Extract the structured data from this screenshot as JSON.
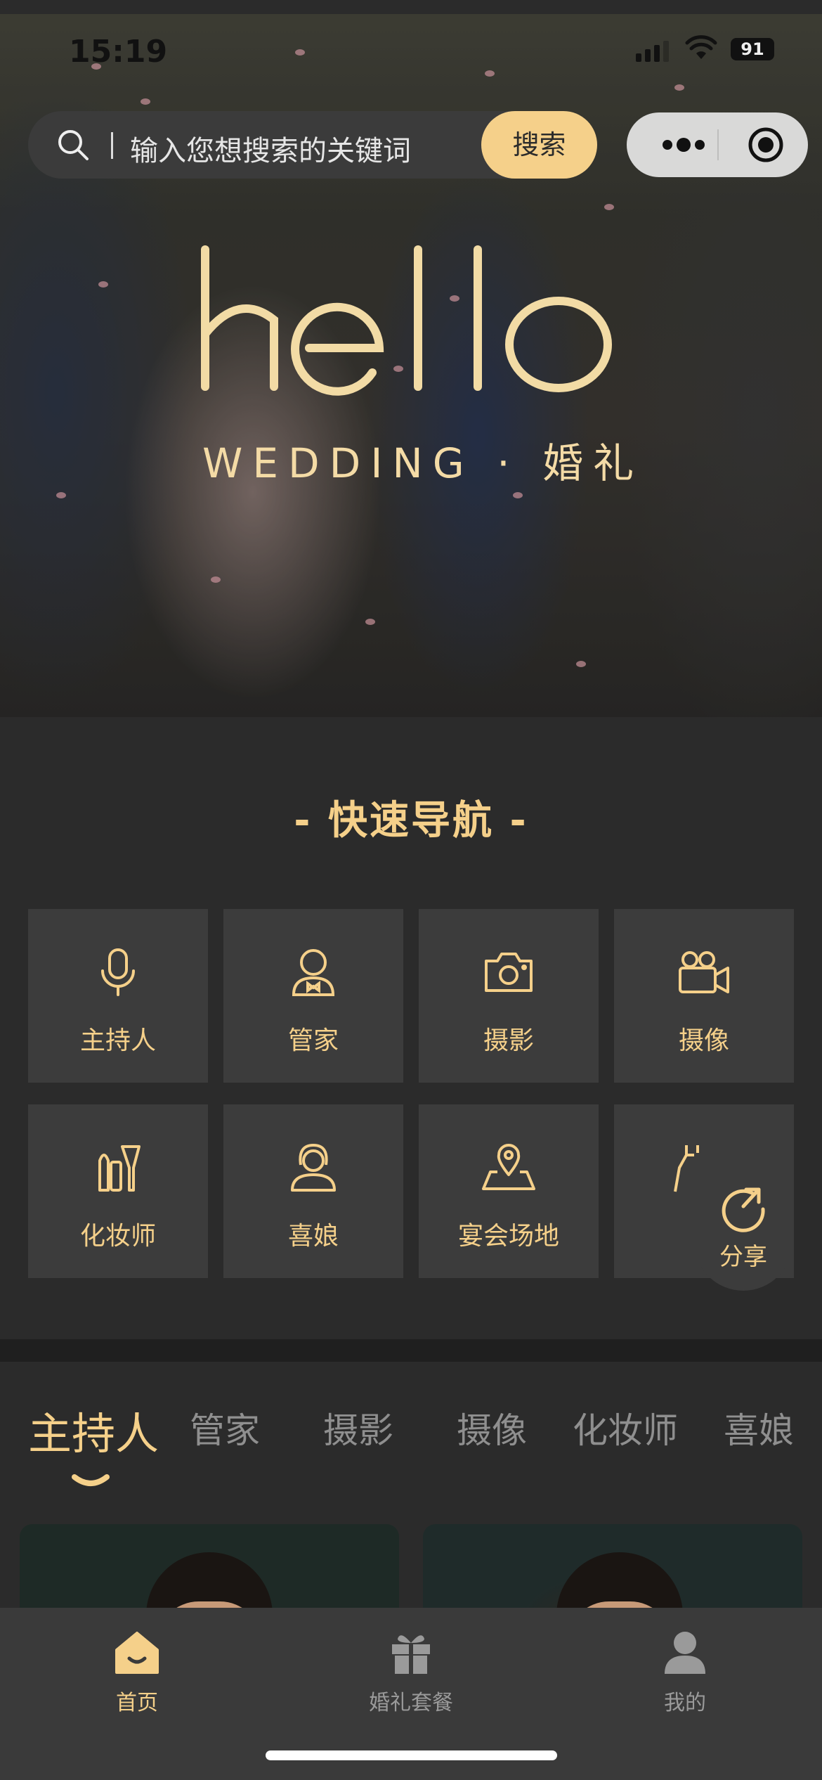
{
  "status": {
    "time": "15:19",
    "battery": "91"
  },
  "search": {
    "placeholder": "输入您想搜索的关键词",
    "button": "搜索"
  },
  "hero": {
    "logo_text": "hello",
    "subtitle": "WEDDING · 婚礼"
  },
  "quick_nav": {
    "title": "- 快速导航 -",
    "items": [
      {
        "label": "主持人",
        "icon": "microphone-icon"
      },
      {
        "label": "管家",
        "icon": "butler-icon"
      },
      {
        "label": "摄影",
        "icon": "camera-icon"
      },
      {
        "label": "摄像",
        "icon": "video-camera-icon"
      },
      {
        "label": "化妆师",
        "icon": "makeup-icon"
      },
      {
        "label": "喜娘",
        "icon": "bridesmaid-icon"
      },
      {
        "label": "宴会场地",
        "icon": "venue-map-icon"
      },
      {
        "label": "",
        "icon": "dress-icon"
      }
    ]
  },
  "share": {
    "label": "分享",
    "icon": "share-icon"
  },
  "category_tabs": [
    {
      "label": "主持人",
      "active": true
    },
    {
      "label": "管家"
    },
    {
      "label": "摄影"
    },
    {
      "label": "摄像"
    },
    {
      "label": "化妆师"
    },
    {
      "label": "喜娘"
    }
  ],
  "tabbar": [
    {
      "label": "首页",
      "icon": "home-icon",
      "active": true
    },
    {
      "label": "婚礼套餐",
      "icon": "gift-icon"
    },
    {
      "label": "我的",
      "icon": "user-icon"
    }
  ],
  "colors": {
    "accent": "#f5d08a",
    "background": "#2b2b2b",
    "tile": "#3c3c3c",
    "inactive": "#8f8f8f"
  }
}
